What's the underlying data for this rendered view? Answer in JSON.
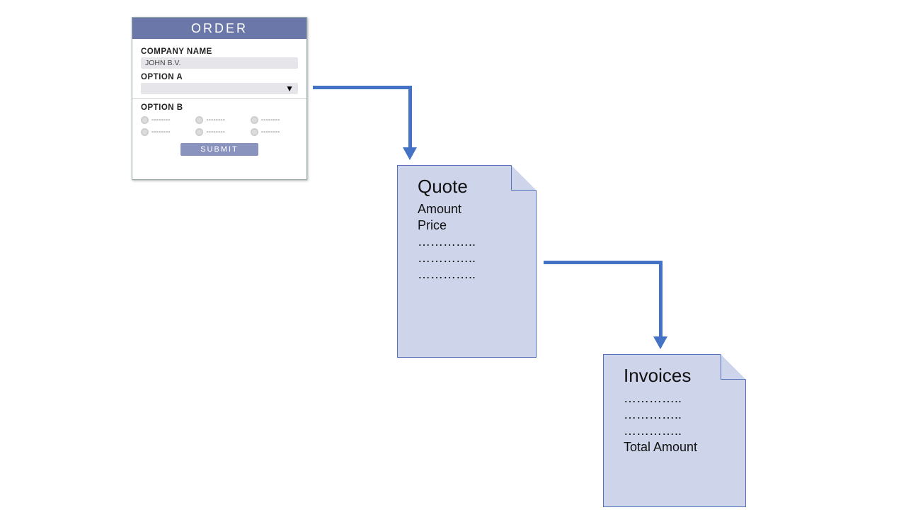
{
  "order_form": {
    "header": "ORDER",
    "company_label": "COMPANY NAME",
    "company_value": "JOHN B.V.",
    "optionA_label": "OPTION A",
    "optionB_label": "OPTION B",
    "radio_placeholder": "--------",
    "submit_label": "SUBMIT"
  },
  "quote": {
    "title": "Quote",
    "line1": "Amount",
    "line2": "Price",
    "line3": "…………..",
    "line4": "…………..",
    "line5": "………….."
  },
  "invoice": {
    "title": "Invoices",
    "line1": "…………..",
    "line2": "…………..",
    "line3": "…………..",
    "line4": "Total Amount"
  }
}
